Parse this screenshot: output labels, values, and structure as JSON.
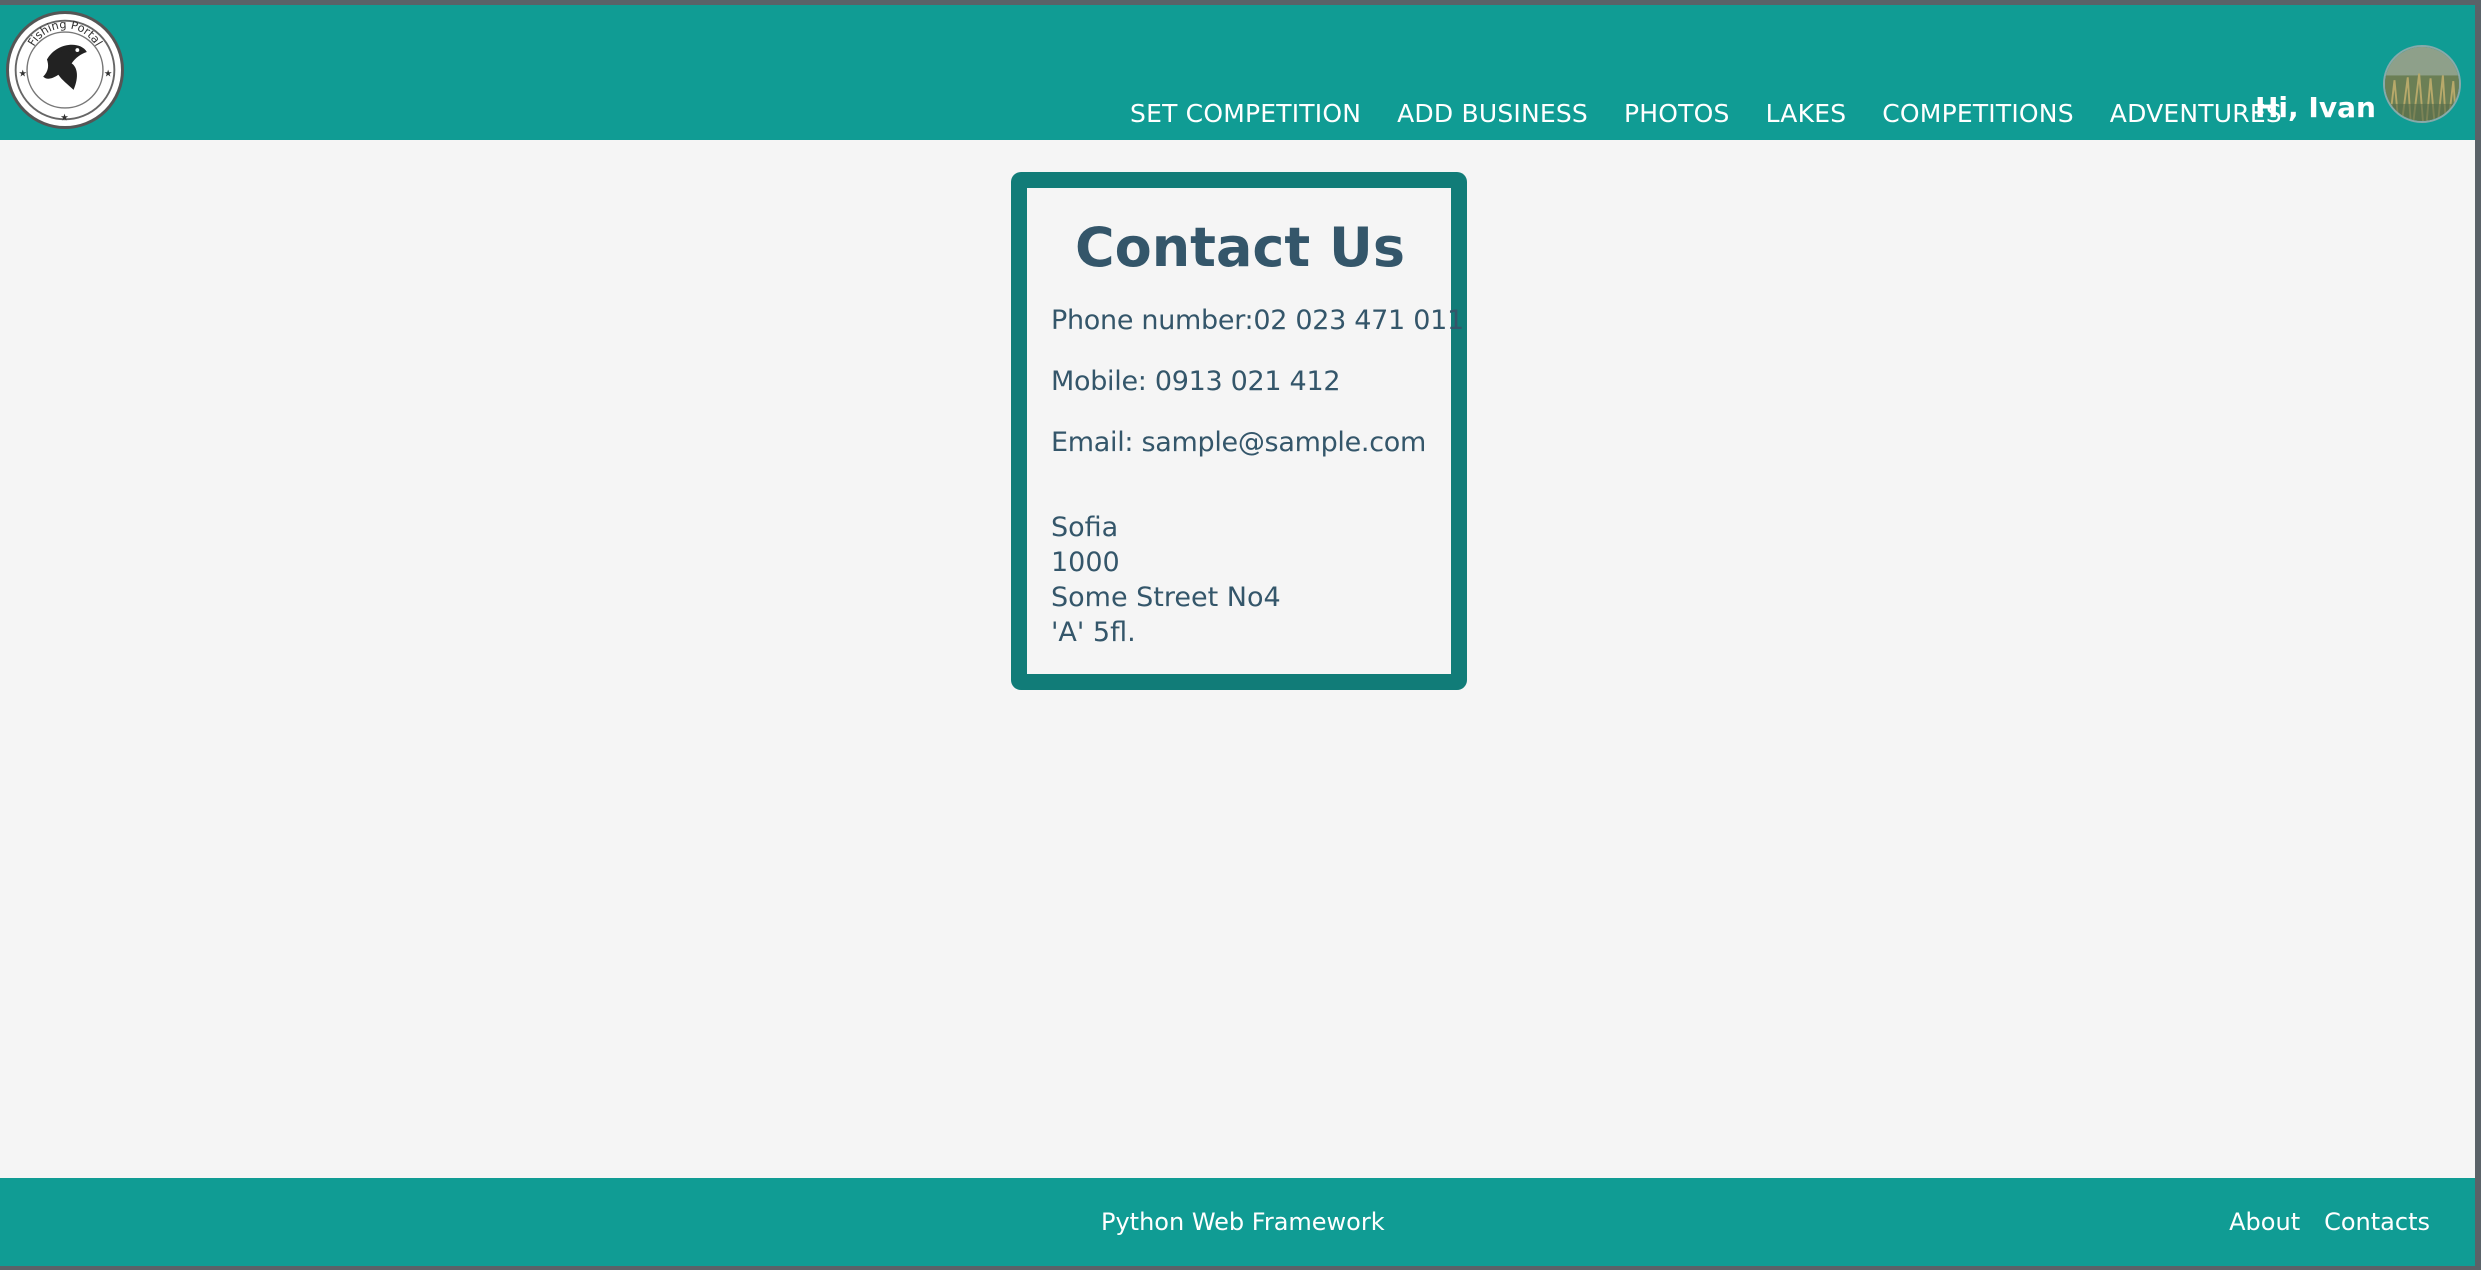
{
  "header": {
    "logo_text": "Fishing Portal",
    "nav": [
      {
        "label": "SET COMPETITION"
      },
      {
        "label": "ADD BUSINESS"
      },
      {
        "label": "PHOTOS"
      },
      {
        "label": "LAKES"
      },
      {
        "label": "COMPETITIONS"
      },
      {
        "label": "ADVENTURES"
      }
    ],
    "greeting": "Hi, Ivan",
    "avatar_icon": "user-avatar"
  },
  "contact": {
    "title": "Contact Us",
    "phone": "Phone number:02 023 471 011",
    "mobile": "Mobile: 0913 021 412",
    "email": "Email: sample@sample.com",
    "address": [
      "Sofia",
      "1000",
      "Some Street No4",
      "'A' 5fl."
    ]
  },
  "footer": {
    "text": "Python Web Framework",
    "links": [
      {
        "label": "About"
      },
      {
        "label": "Contacts"
      }
    ]
  },
  "colors": {
    "header": "#109c94",
    "card_border": "#117c78",
    "text": "#34566a",
    "background": "#f5f5f5"
  }
}
